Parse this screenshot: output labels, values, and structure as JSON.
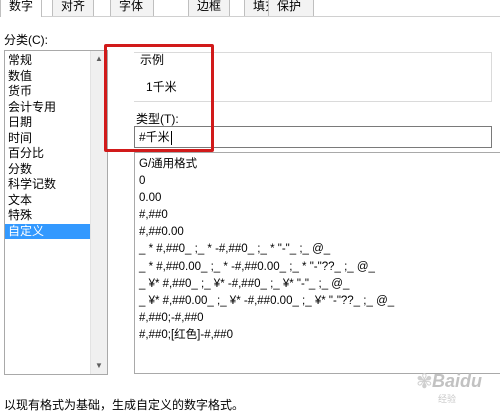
{
  "tabs": [
    {
      "label": "数字"
    },
    {
      "label": "对齐"
    },
    {
      "label": "字体"
    },
    {
      "label": "边框"
    },
    {
      "label": "填充"
    },
    {
      "label": "保护"
    }
  ],
  "category": {
    "label": "分类(C):",
    "items": [
      {
        "label": "常规"
      },
      {
        "label": "数值"
      },
      {
        "label": "货币"
      },
      {
        "label": "会计专用"
      },
      {
        "label": "日期"
      },
      {
        "label": "时间"
      },
      {
        "label": "百分比"
      },
      {
        "label": "分数"
      },
      {
        "label": "科学记数"
      },
      {
        "label": "文本"
      },
      {
        "label": "特殊"
      },
      {
        "label": "自定义"
      }
    ],
    "selected_index": 11
  },
  "sample": {
    "label": "示例",
    "value": "1千米"
  },
  "type_field": {
    "label": "类型(T):",
    "value": "#千米"
  },
  "formats": [
    {
      "text": "G/通用格式"
    },
    {
      "text": "0"
    },
    {
      "text": "0.00"
    },
    {
      "text": "#,##0"
    },
    {
      "text": "#,##0.00"
    },
    {
      "text": "_ * #,##0_ ;_ * -#,##0_ ;_ * \"-\"_ ;_ @_"
    },
    {
      "text": "_ * #,##0.00_ ;_ * -#,##0.00_ ;_ * \"-\"??_ ;_ @_"
    },
    {
      "text": "_ ¥* #,##0_ ;_ ¥* -#,##0_ ;_ ¥* \"-\"_ ;_ @_"
    },
    {
      "text": "_ ¥* #,##0.00_ ;_ ¥* -#,##0.00_ ;_ ¥* \"-\"??_ ;_ @_"
    },
    {
      "text": "#,##0;-#,##0"
    },
    {
      "text": "#,##0;[红色]-#,##0"
    }
  ],
  "footer": {
    "description": "以现有格式为基础，生成自定义的数字格式。"
  },
  "watermark": {
    "text": "Baidu",
    "sub": "经验"
  },
  "colors": {
    "highlight_border": "#d11a1a",
    "selection": "#3399ff"
  }
}
